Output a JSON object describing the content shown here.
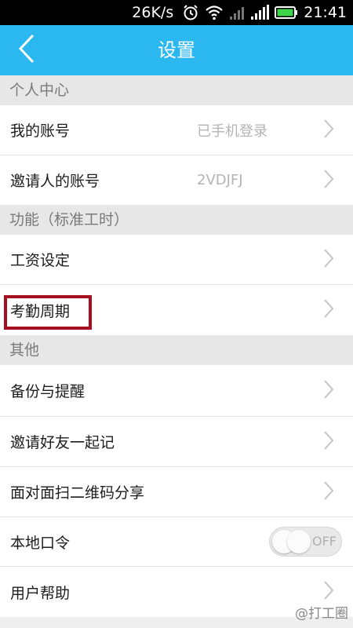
{
  "status_bar": {
    "network_speed": "26K/s",
    "time": "21:41",
    "icons": [
      "alarm-icon",
      "wifi-icon",
      "cell-signal-icon",
      "signal-bars-icon",
      "battery-icon"
    ]
  },
  "header": {
    "title": "设置",
    "back_icon": "chevron-left-icon",
    "background_color": "#2bb7f0"
  },
  "sections": [
    {
      "title": "个人中心",
      "items": [
        {
          "label": "我的账号",
          "value": "已手机登录"
        },
        {
          "label": "邀请人的账号",
          "value": "2VDJFJ"
        }
      ]
    },
    {
      "title": "功能（标准工时）",
      "items": [
        {
          "label": "工资设定"
        },
        {
          "label": "考勤周期",
          "highlighted": true
        }
      ]
    },
    {
      "title": "其他",
      "items": [
        {
          "label": "备份与提醒"
        },
        {
          "label": "邀请好友一起记"
        },
        {
          "label": "面对面扫二维码分享"
        },
        {
          "label": "本地口令",
          "toggle_text": "OFF",
          "toggle_state": "off"
        },
        {
          "label": "用户帮助"
        }
      ]
    }
  ],
  "highlight_color": "#a60f1d",
  "watermark": "@打工圈"
}
